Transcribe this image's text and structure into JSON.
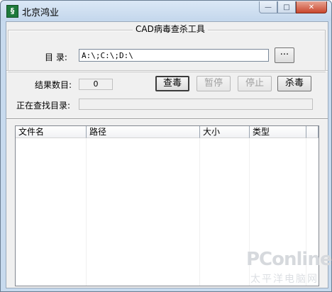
{
  "window": {
    "title": "北京鸿业",
    "icon": "app-logo-icon"
  },
  "caption": {
    "minimize": "—",
    "maximize": "□",
    "close": "✕"
  },
  "group": {
    "title": "CAD病毒查杀工具"
  },
  "directory": {
    "label": "目 录:",
    "value": "A:\\;C:\\;D:\\",
    "browse_label": "···"
  },
  "result": {
    "label": "结果数目:",
    "count": "0"
  },
  "buttons": {
    "scan": "查毒",
    "pause": "暂停",
    "stop": "停止",
    "kill": "杀毒"
  },
  "searching": {
    "label": "正在查找目录:",
    "value": ""
  },
  "table": {
    "columns": [
      "文件名",
      "路径",
      "大小",
      "类型"
    ],
    "rows": []
  },
  "watermark": {
    "brand": "PConline",
    "tagline": "太平洋电脑网"
  }
}
